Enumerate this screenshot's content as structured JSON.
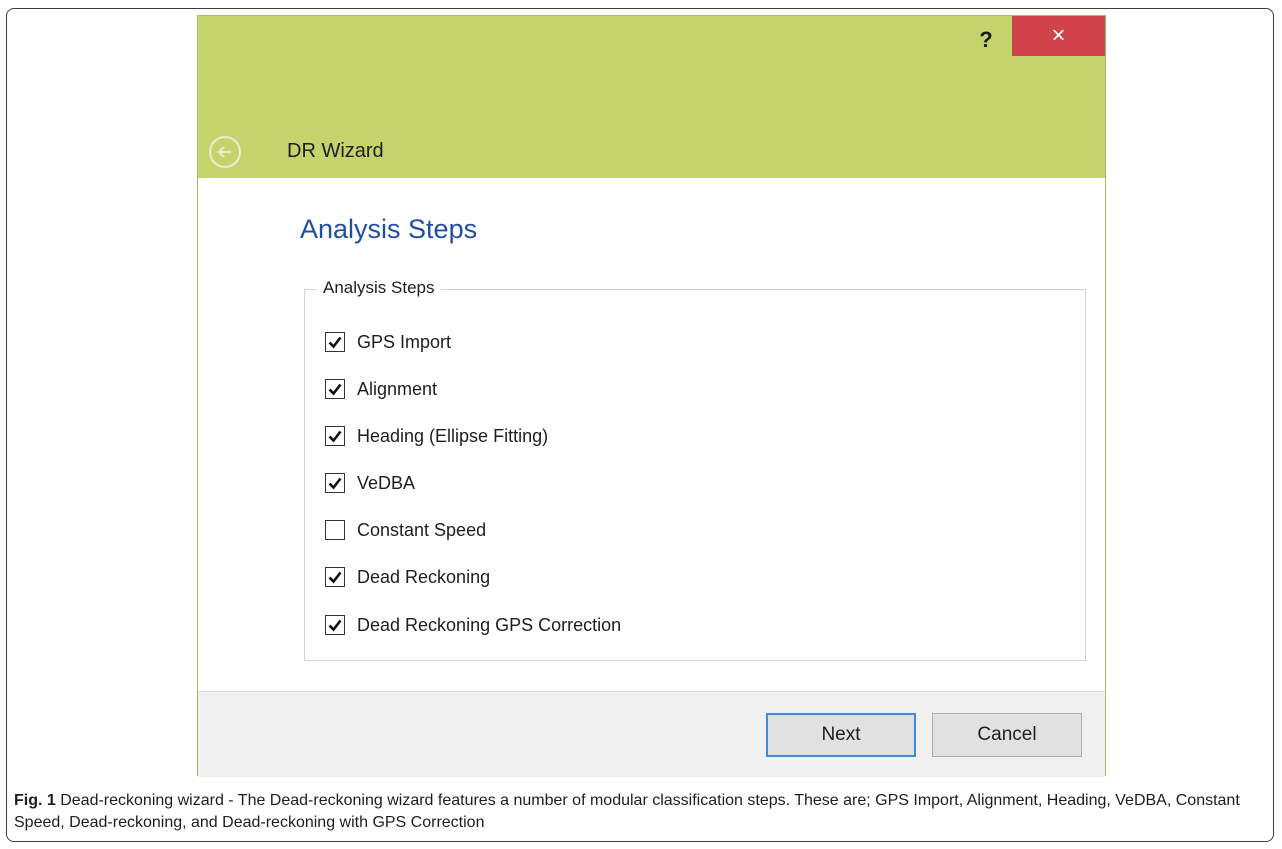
{
  "window": {
    "title": "DR Wizard",
    "help_label": "?",
    "close_label": "×"
  },
  "page": {
    "heading": "Analysis Steps"
  },
  "group": {
    "legend": "Analysis Steps",
    "items": [
      {
        "label": "GPS Import",
        "checked": true
      },
      {
        "label": "Alignment",
        "checked": true
      },
      {
        "label": "Heading (Ellipse Fitting)",
        "checked": true
      },
      {
        "label": "VeDBA",
        "checked": true
      },
      {
        "label": "Constant Speed",
        "checked": false
      },
      {
        "label": "Dead Reckoning",
        "checked": true
      },
      {
        "label": "Dead Reckoning GPS Correction",
        "checked": true
      }
    ]
  },
  "footer": {
    "next_label": "Next",
    "cancel_label": "Cancel"
  },
  "caption": {
    "prefix": "Fig. 1",
    "text": " Dead-reckoning wizard - The Dead-reckoning wizard features a number of modular classification steps. These are; GPS Import, Alignment, Heading, VeDBA, Constant Speed, Dead-reckoning, and Dead-reckoning with GPS Correction"
  },
  "colors": {
    "titlebar": "#c5d36d",
    "close": "#d0434a",
    "heading": "#1f4fa0",
    "focus": "#3c8edb"
  }
}
